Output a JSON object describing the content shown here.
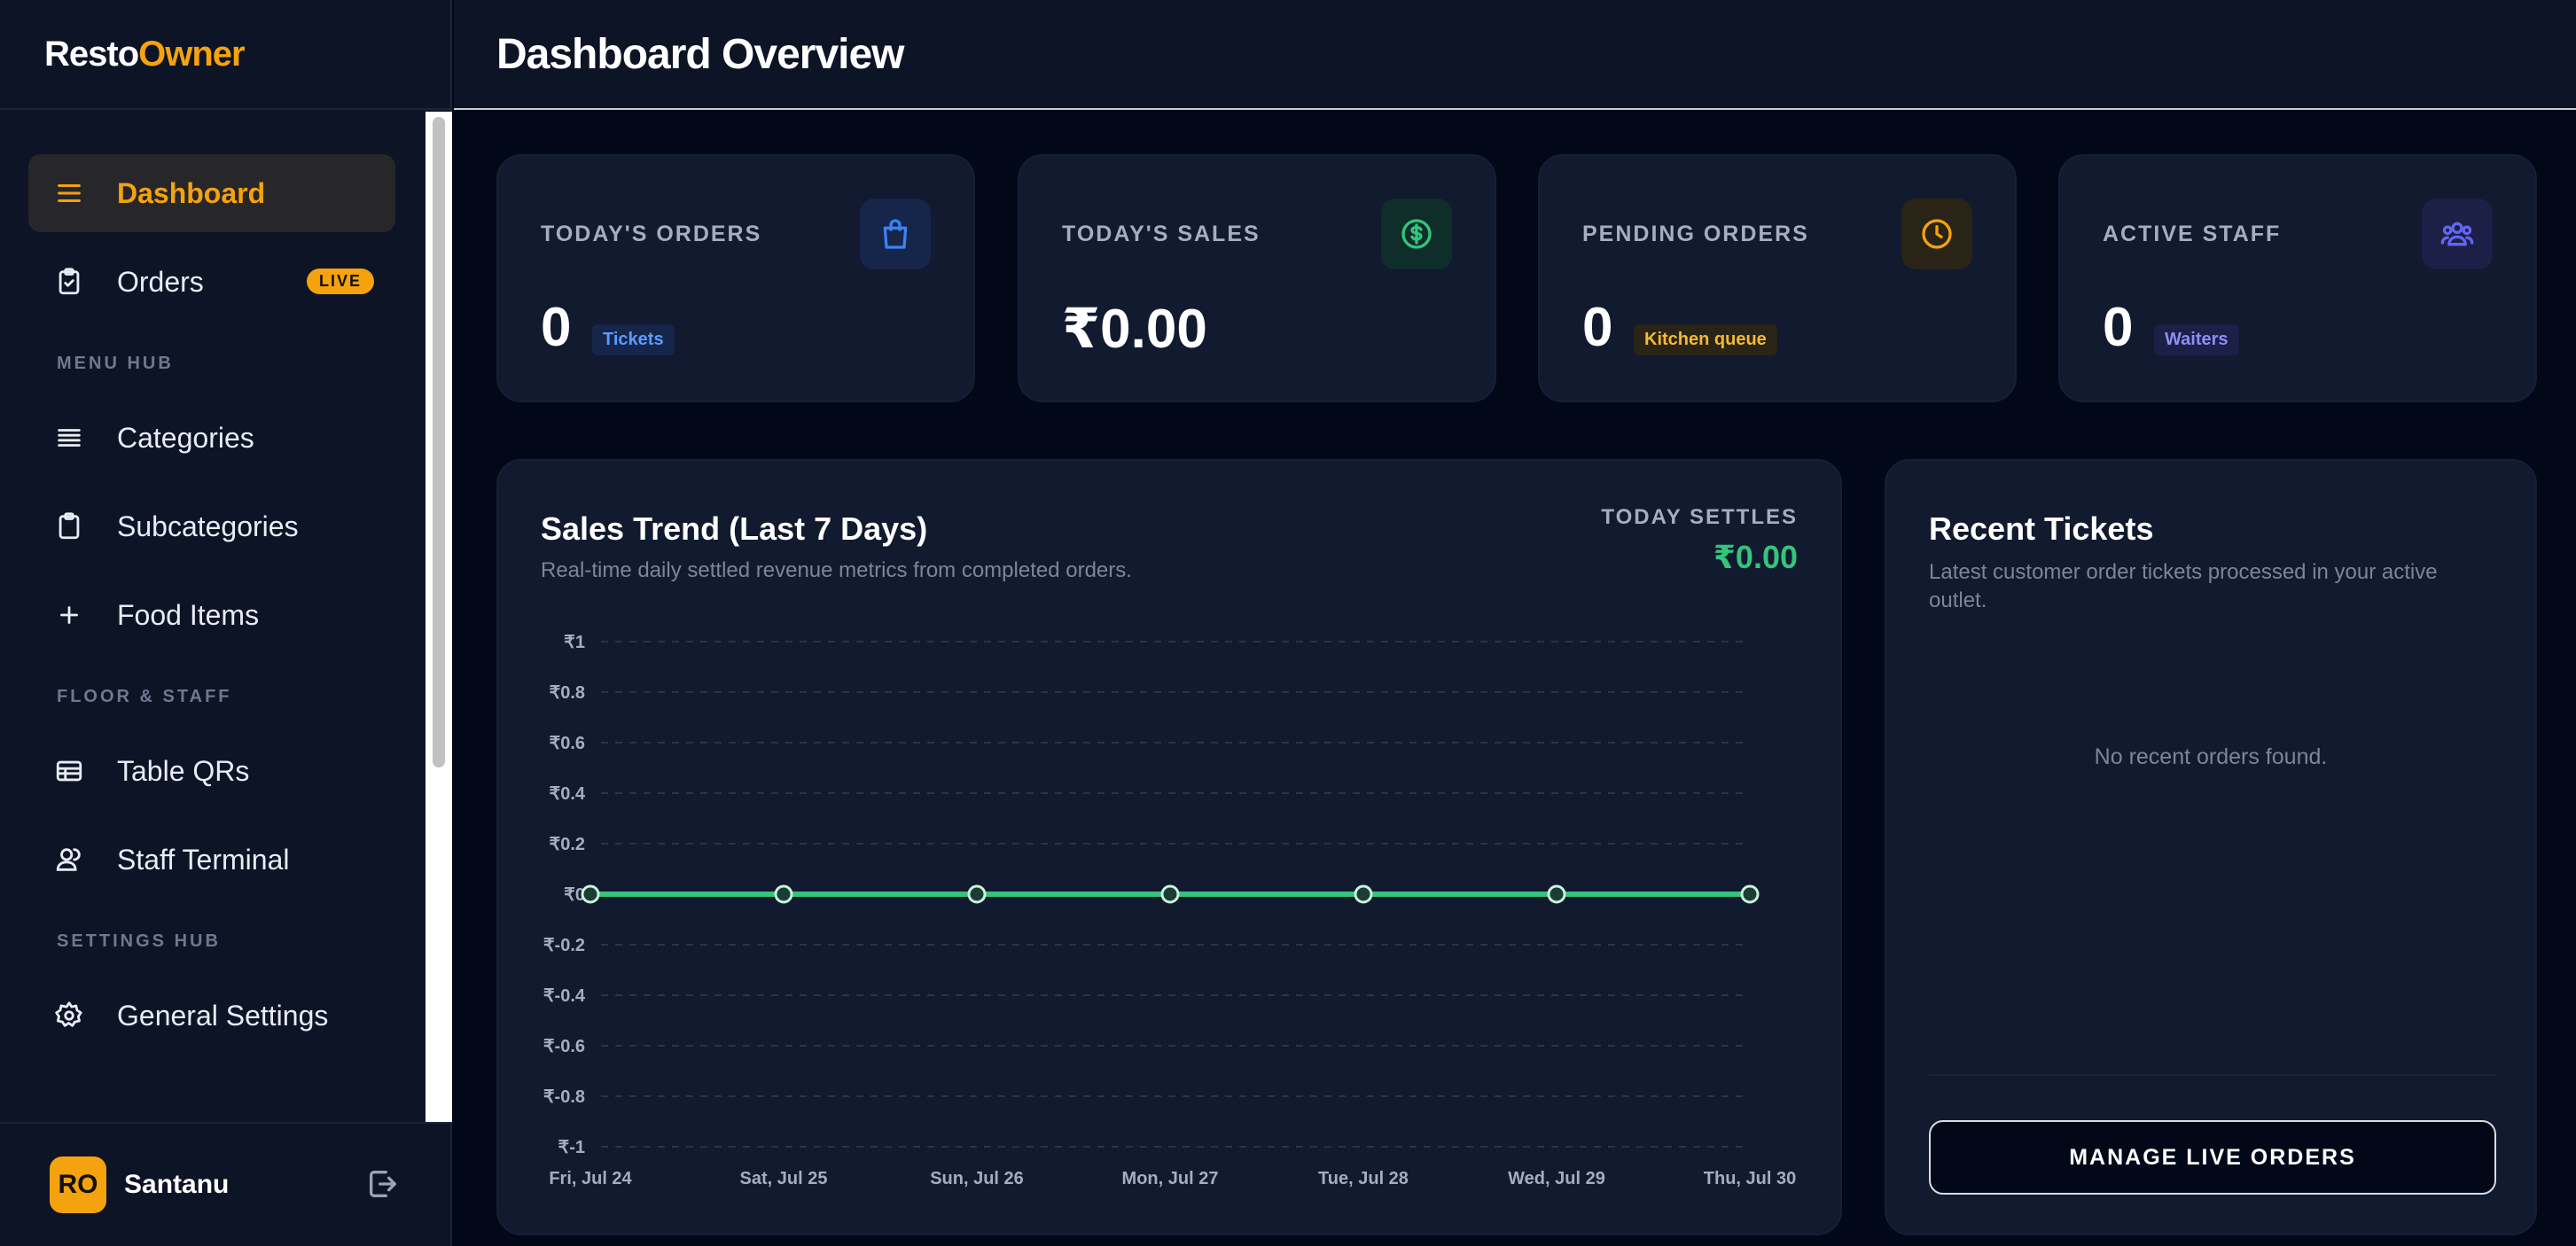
{
  "brand": {
    "part1": "Resto",
    "part2": "Owner"
  },
  "sidebar": {
    "items": [
      {
        "label": "Dashboard",
        "icon": "menu-lines-icon",
        "active": true
      },
      {
        "label": "Orders",
        "icon": "clipboard-check-icon",
        "badge": "LIVE"
      }
    ],
    "sections": [
      {
        "title": "MENU HUB",
        "items": [
          {
            "label": "Categories",
            "icon": "list-icon"
          },
          {
            "label": "Subcategories",
            "icon": "clipboard-icon"
          },
          {
            "label": "Food Items",
            "icon": "plus-icon"
          }
        ]
      },
      {
        "title": "FLOOR & STAFF",
        "items": [
          {
            "label": "Table QRs",
            "icon": "table-icon"
          },
          {
            "label": "Staff Terminal",
            "icon": "users-icon"
          }
        ]
      },
      {
        "title": "SETTINGS HUB",
        "items": [
          {
            "label": "General Settings",
            "icon": "gear-icon"
          }
        ]
      }
    ],
    "user": {
      "initials": "RO",
      "name": "Santanu"
    }
  },
  "header": {
    "title": "Dashboard Overview"
  },
  "stats": [
    {
      "label": "TODAY'S ORDERS",
      "value": "0",
      "chip": "Tickets",
      "icon": "shopping-bag-icon",
      "color": "#3b82f6"
    },
    {
      "label": "TODAY'S SALES",
      "value": "₹0.00",
      "chip": "",
      "icon": "dollar-circle-icon",
      "color": "#34c47c"
    },
    {
      "label": "PENDING ORDERS",
      "value": "0",
      "chip": "Kitchen queue",
      "icon": "clock-icon",
      "color": "#f5a20f"
    },
    {
      "label": "ACTIVE STAFF",
      "value": "0",
      "chip": "Waiters",
      "icon": "users-icon",
      "color": "#6366f1"
    }
  ],
  "sales_trend": {
    "title": "Sales Trend (Last 7 Days)",
    "subtitle": "Real-time daily settled revenue metrics from completed orders.",
    "settle_label": "TODAY SETTLES",
    "settle_value": "₹0.00"
  },
  "chart_data": {
    "type": "line",
    "categories": [
      "Fri, Jul 24",
      "Sat, Jul 25",
      "Sun, Jul 26",
      "Mon, Jul 27",
      "Tue, Jul 28",
      "Wed, Jul 29",
      "Thu, Jul 30"
    ],
    "series": [
      {
        "values": [
          0,
          0,
          0,
          0,
          0,
          0,
          0
        ],
        "color": "#34c47c"
      }
    ],
    "ylim": [
      -1,
      1
    ],
    "yticks": [
      "₹1",
      "₹0.8",
      "₹0.6",
      "₹0.4",
      "₹0.2",
      "₹0",
      "₹-0.2",
      "₹-0.4",
      "₹-0.6",
      "₹-0.8",
      "₹-1"
    ],
    "ytick_values": [
      1,
      0.8,
      0.6,
      0.4,
      0.2,
      0,
      -0.2,
      -0.4,
      -0.6,
      -0.8,
      -1
    ],
    "grid": true,
    "title": "",
    "xlabel": "",
    "ylabel": ""
  },
  "recent_tickets": {
    "title": "Recent Tickets",
    "subtitle": "Latest customer order tickets processed in your active outlet.",
    "empty": "No recent orders found.",
    "button": "MANAGE LIVE ORDERS"
  }
}
